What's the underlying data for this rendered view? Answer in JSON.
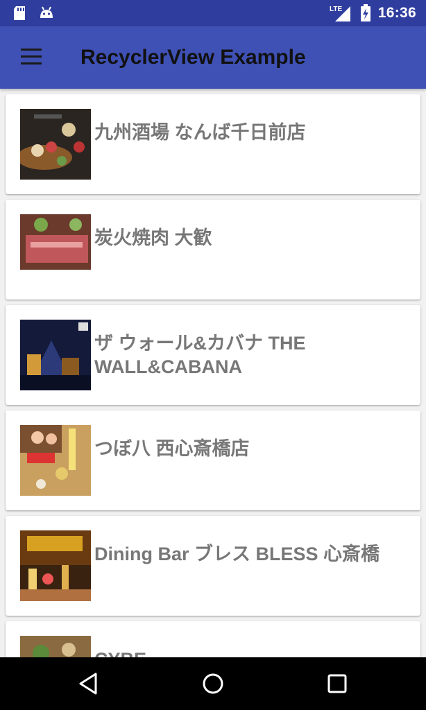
{
  "status_bar": {
    "time": "16:36",
    "network": "LTE",
    "icons": [
      "sd-card-icon",
      "android-icon",
      "signal-icon",
      "battery-charging-icon"
    ]
  },
  "app_bar": {
    "title": "RecyclerView Example",
    "menu_icon": "hamburger-menu-icon"
  },
  "restaurants": [
    {
      "name": "九州酒場 なんば千日前店"
    },
    {
      "name": "炭火焼肉 大歓"
    },
    {
      "name": "ザ ウォール&カバナ THE WALL&CABANA"
    },
    {
      "name": "つぼ八 西心斎橋店"
    },
    {
      "name": "Dining Bar ブレス BLESS 心斎橋"
    },
    {
      "name": "CYBE"
    }
  ],
  "nav_bar": {
    "buttons": [
      "back-icon",
      "home-icon",
      "recents-icon"
    ]
  }
}
